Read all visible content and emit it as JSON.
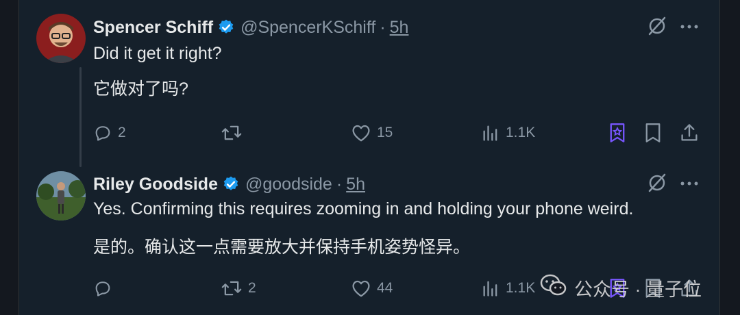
{
  "tweets": [
    {
      "name": "Spencer Schiff",
      "handle": "@SpencerKSchiff",
      "separator": "·",
      "time": "5h",
      "text_en": "Did it get it right?",
      "text_zh": "它做对了吗?",
      "replies": "2",
      "retweets": "",
      "likes": "15",
      "views": "1.1K"
    },
    {
      "name": "Riley Goodside",
      "handle": "@goodside",
      "separator": "·",
      "time": "5h",
      "text_en": "Yes. Confirming this requires zooming in and holding your phone weird.",
      "text_zh": "是的。确认这一点需要放大并保持手机姿势怪异。",
      "replies": "",
      "retweets": "2",
      "likes": "44",
      "views": "1.1K"
    }
  ],
  "watermark": {
    "text": "公众号 · 量子位"
  },
  "colors": {
    "background": "#15202b",
    "text": "#e7e9ea",
    "muted": "#8b98a5",
    "verified": "#1d9bf0",
    "bookmark_active": "#7856ff"
  },
  "icons": [
    "grok-icon",
    "more-icon",
    "reply-icon",
    "retweet-icon",
    "like-icon",
    "views-icon",
    "premium-bookmark-icon",
    "bookmark-icon",
    "share-icon",
    "verified-badge-icon",
    "wechat-icon"
  ]
}
